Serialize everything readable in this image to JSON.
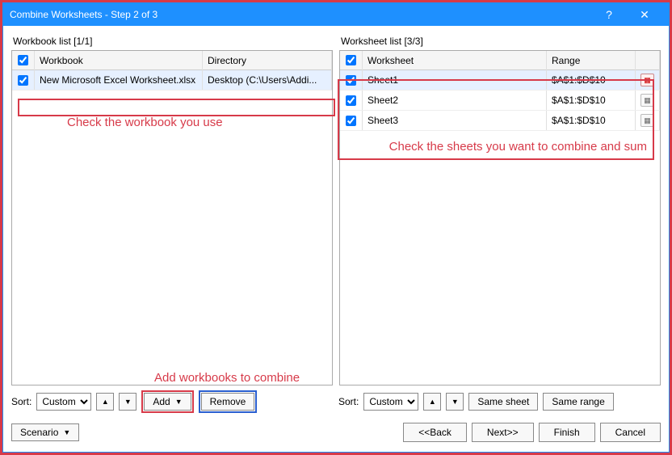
{
  "title": "Combine Worksheets - Step 2 of 3",
  "workbook": {
    "listLabel": "Workbook list [1/1]",
    "headers": {
      "name": "Workbook",
      "dir": "Directory"
    },
    "rows": [
      {
        "name": "New Microsoft Excel Worksheet.xlsx",
        "dir": "Desktop (C:\\Users\\Addi..."
      }
    ],
    "sortLabel": "Sort:",
    "sortValue": "Custom",
    "addLabel": "Add",
    "removeLabel": "Remove"
  },
  "worksheet": {
    "listLabel": "Worksheet list [3/3]",
    "headers": {
      "name": "Worksheet",
      "range": "Range"
    },
    "rows": [
      {
        "name": "Sheet1",
        "range": "$A$1:$D$10"
      },
      {
        "name": "Sheet2",
        "range": "$A$1:$D$10"
      },
      {
        "name": "Sheet3",
        "range": "$A$1:$D$10"
      }
    ],
    "sortLabel": "Sort:",
    "sortValue": "Custom",
    "sameSheet": "Same sheet",
    "sameRange": "Same range"
  },
  "annotations": {
    "wb": "Check the workbook you use",
    "ws": "Check the sheets you want to combine and sum",
    "add": "Add workbooks to combine"
  },
  "footer": {
    "scenario": "Scenario",
    "back": "<<Back",
    "next": "Next>>",
    "finish": "Finish",
    "cancel": "Cancel"
  },
  "glyph": {
    "up": "▲",
    "down": "▼",
    "help": "?",
    "close": "✕",
    "dd": "▼"
  }
}
